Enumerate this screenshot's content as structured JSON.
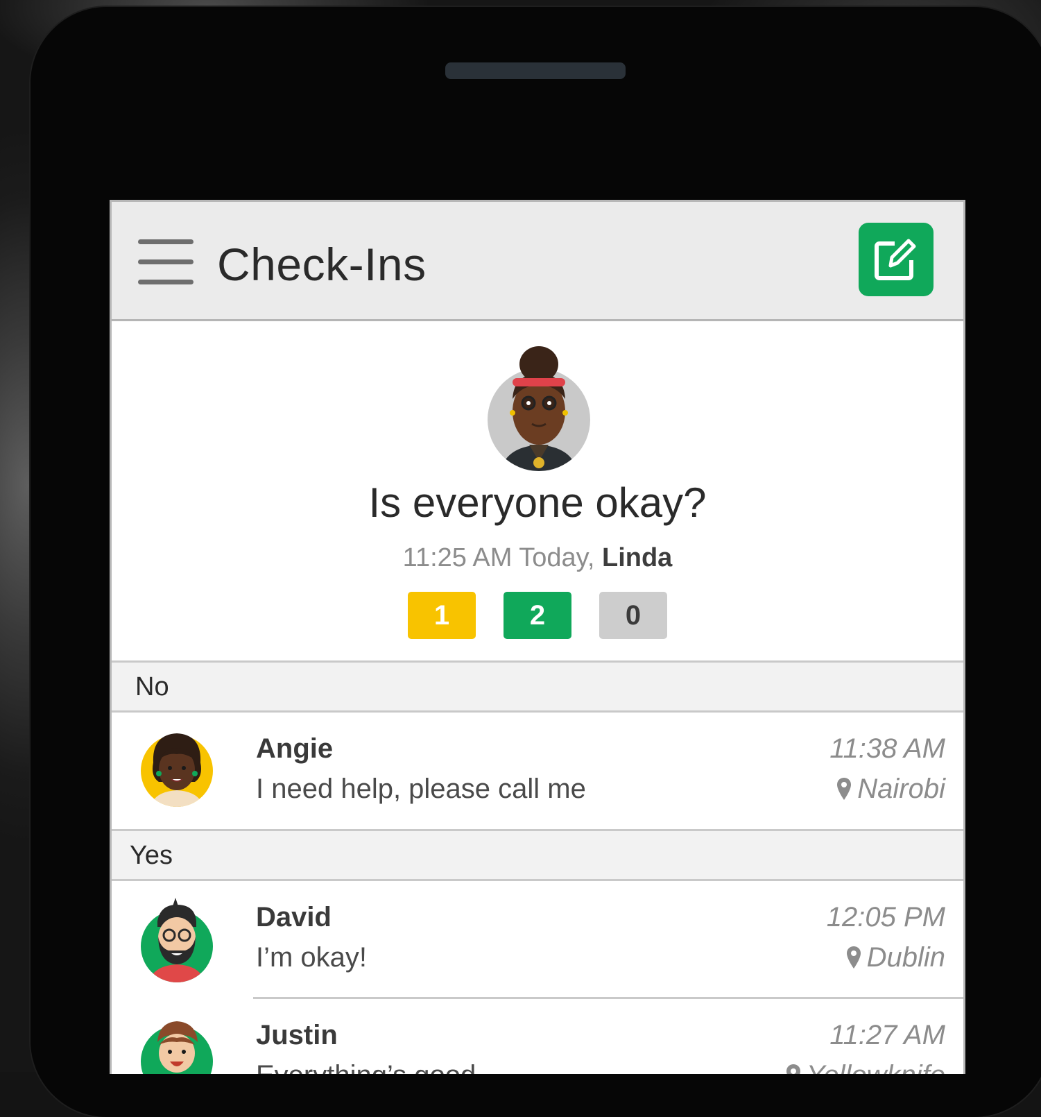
{
  "app": {
    "title": "Check-Ins",
    "compose_icon": "compose-icon",
    "menu_icon": "hamburger-icon"
  },
  "checkin": {
    "question": "Is everyone okay?",
    "time": "11:25 AM Today, ",
    "author": "Linda",
    "counts": {
      "no": "1",
      "yes": "2",
      "none": "0"
    }
  },
  "sections": {
    "no_label": "No",
    "yes_label": "Yes"
  },
  "responses": [
    {
      "name": "Angie",
      "message": "I need help, please call me",
      "time": "11:38 AM",
      "location": "Nairobi"
    },
    {
      "name": "David",
      "message": "I’m okay!",
      "time": "12:05 PM",
      "location": "Dublin"
    },
    {
      "name": "Justin",
      "message": "Everything’s good",
      "time": "11:27 AM",
      "location": "Yellowknife"
    }
  ],
  "colors": {
    "accent_green": "#10a85a",
    "no_yellow": "#f8c300",
    "none_gray": "#cdcdcd"
  }
}
